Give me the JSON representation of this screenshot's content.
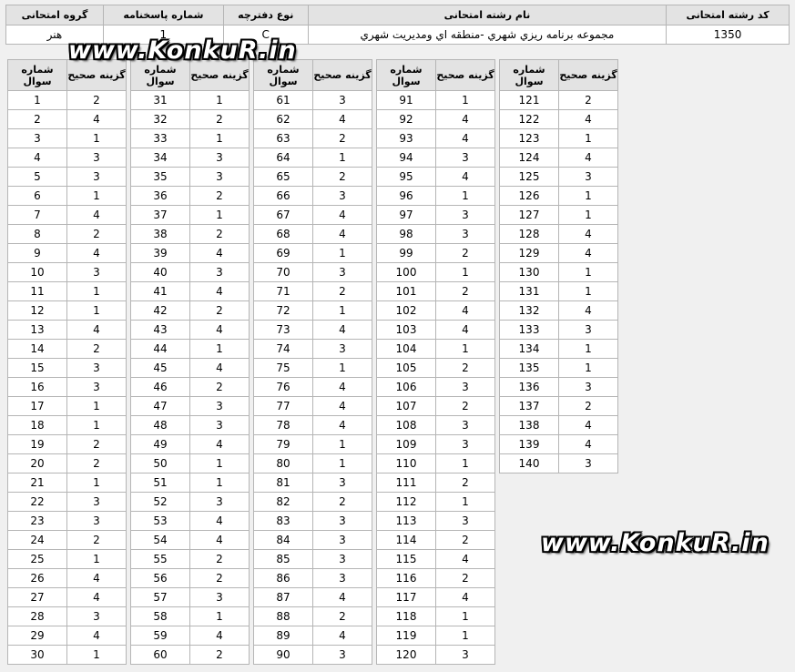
{
  "header": {
    "columns": [
      "کد رشته امتحانی",
      "نام رشته امتحانی",
      "نوع دفترچه",
      "شماره پاسخنامه",
      "گروه امتحانی"
    ],
    "row": [
      "1350",
      "مجموعه برنامه ريزي شهري -منطقه اي ومديريت شهري",
      "C",
      "1",
      "هنر"
    ]
  },
  "answer_headers": {
    "question": "شماره سوال",
    "answer": "گزینه صحیح"
  },
  "answer_columns": [
    [
      [
        1,
        2
      ],
      [
        2,
        4
      ],
      [
        3,
        1
      ],
      [
        4,
        3
      ],
      [
        5,
        3
      ],
      [
        6,
        1
      ],
      [
        7,
        4
      ],
      [
        8,
        2
      ],
      [
        9,
        4
      ],
      [
        10,
        3
      ],
      [
        11,
        1
      ],
      [
        12,
        1
      ],
      [
        13,
        4
      ],
      [
        14,
        2
      ],
      [
        15,
        3
      ],
      [
        16,
        3
      ],
      [
        17,
        1
      ],
      [
        18,
        1
      ],
      [
        19,
        2
      ],
      [
        20,
        2
      ],
      [
        21,
        1
      ],
      [
        22,
        3
      ],
      [
        23,
        3
      ],
      [
        24,
        2
      ],
      [
        25,
        1
      ],
      [
        26,
        4
      ],
      [
        27,
        4
      ],
      [
        28,
        3
      ],
      [
        29,
        4
      ],
      [
        30,
        1
      ]
    ],
    [
      [
        31,
        1
      ],
      [
        32,
        2
      ],
      [
        33,
        1
      ],
      [
        34,
        3
      ],
      [
        35,
        3
      ],
      [
        36,
        2
      ],
      [
        37,
        1
      ],
      [
        38,
        2
      ],
      [
        39,
        4
      ],
      [
        40,
        3
      ],
      [
        41,
        4
      ],
      [
        42,
        2
      ],
      [
        43,
        4
      ],
      [
        44,
        1
      ],
      [
        45,
        4
      ],
      [
        46,
        2
      ],
      [
        47,
        3
      ],
      [
        48,
        3
      ],
      [
        49,
        4
      ],
      [
        50,
        1
      ],
      [
        51,
        1
      ],
      [
        52,
        3
      ],
      [
        53,
        4
      ],
      [
        54,
        4
      ],
      [
        55,
        2
      ],
      [
        56,
        2
      ],
      [
        57,
        3
      ],
      [
        58,
        1
      ],
      [
        59,
        4
      ],
      [
        60,
        2
      ]
    ],
    [
      [
        61,
        3
      ],
      [
        62,
        4
      ],
      [
        63,
        2
      ],
      [
        64,
        1
      ],
      [
        65,
        2
      ],
      [
        66,
        3
      ],
      [
        67,
        4
      ],
      [
        68,
        4
      ],
      [
        69,
        1
      ],
      [
        70,
        3
      ],
      [
        71,
        2
      ],
      [
        72,
        1
      ],
      [
        73,
        4
      ],
      [
        74,
        3
      ],
      [
        75,
        1
      ],
      [
        76,
        4
      ],
      [
        77,
        4
      ],
      [
        78,
        4
      ],
      [
        79,
        1
      ],
      [
        80,
        1
      ],
      [
        81,
        3
      ],
      [
        82,
        2
      ],
      [
        83,
        3
      ],
      [
        84,
        3
      ],
      [
        85,
        3
      ],
      [
        86,
        3
      ],
      [
        87,
        4
      ],
      [
        88,
        2
      ],
      [
        89,
        4
      ],
      [
        90,
        3
      ]
    ],
    [
      [
        91,
        1
      ],
      [
        92,
        4
      ],
      [
        93,
        4
      ],
      [
        94,
        3
      ],
      [
        95,
        4
      ],
      [
        96,
        1
      ],
      [
        97,
        3
      ],
      [
        98,
        3
      ],
      [
        99,
        2
      ],
      [
        100,
        1
      ],
      [
        101,
        2
      ],
      [
        102,
        4
      ],
      [
        103,
        4
      ],
      [
        104,
        1
      ],
      [
        105,
        2
      ],
      [
        106,
        3
      ],
      [
        107,
        2
      ],
      [
        108,
        3
      ],
      [
        109,
        3
      ],
      [
        110,
        1
      ],
      [
        111,
        2
      ],
      [
        112,
        1
      ],
      [
        113,
        3
      ],
      [
        114,
        2
      ],
      [
        115,
        4
      ],
      [
        116,
        2
      ],
      [
        117,
        4
      ],
      [
        118,
        1
      ],
      [
        119,
        1
      ],
      [
        120,
        3
      ]
    ],
    [
      [
        121,
        2
      ],
      [
        122,
        4
      ],
      [
        123,
        1
      ],
      [
        124,
        4
      ],
      [
        125,
        3
      ],
      [
        126,
        1
      ],
      [
        127,
        1
      ],
      [
        128,
        4
      ],
      [
        129,
        4
      ],
      [
        130,
        1
      ],
      [
        131,
        1
      ],
      [
        132,
        4
      ],
      [
        133,
        3
      ],
      [
        134,
        1
      ],
      [
        135,
        1
      ],
      [
        136,
        3
      ],
      [
        137,
        2
      ],
      [
        138,
        4
      ],
      [
        139,
        4
      ],
      [
        140,
        3
      ]
    ]
  ],
  "watermarks": [
    "www.KonkuR.in",
    "www.KonkuR.in"
  ]
}
